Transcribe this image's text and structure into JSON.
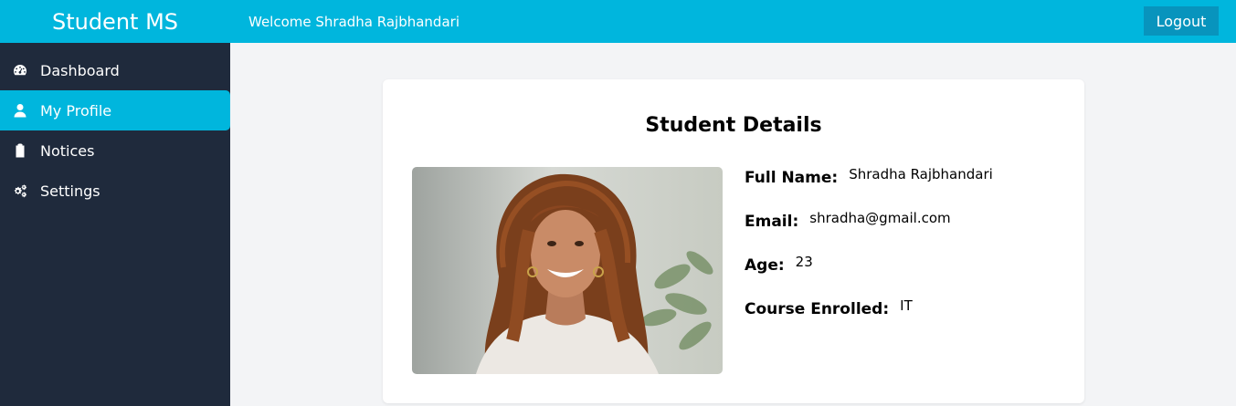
{
  "header": {
    "brand": "Student MS",
    "welcome": "Welcome Shradha Rajbhandari",
    "logout_label": "Logout"
  },
  "sidebar": {
    "items": [
      {
        "label": "Dashboard",
        "icon": "speedometer-icon"
      },
      {
        "label": "My Profile",
        "icon": "user-icon",
        "active": true
      },
      {
        "label": "Notices",
        "icon": "clipboard-icon"
      },
      {
        "label": "Settings",
        "icon": "gears-icon"
      }
    ]
  },
  "card": {
    "title": "Student Details",
    "fields": [
      {
        "label": "Full Name:",
        "value": "Shradha Rajbhandari"
      },
      {
        "label": "Email:",
        "value": "shradha@gmail.com"
      },
      {
        "label": "Age:",
        "value": "23"
      },
      {
        "label": "Course Enrolled:",
        "value": "IT"
      }
    ]
  },
  "colors": {
    "accent": "#00b6dd",
    "logout_bg": "#0894bd",
    "sidebar_bg": "#1f2a3c",
    "page_bg": "#f3f4f6"
  }
}
